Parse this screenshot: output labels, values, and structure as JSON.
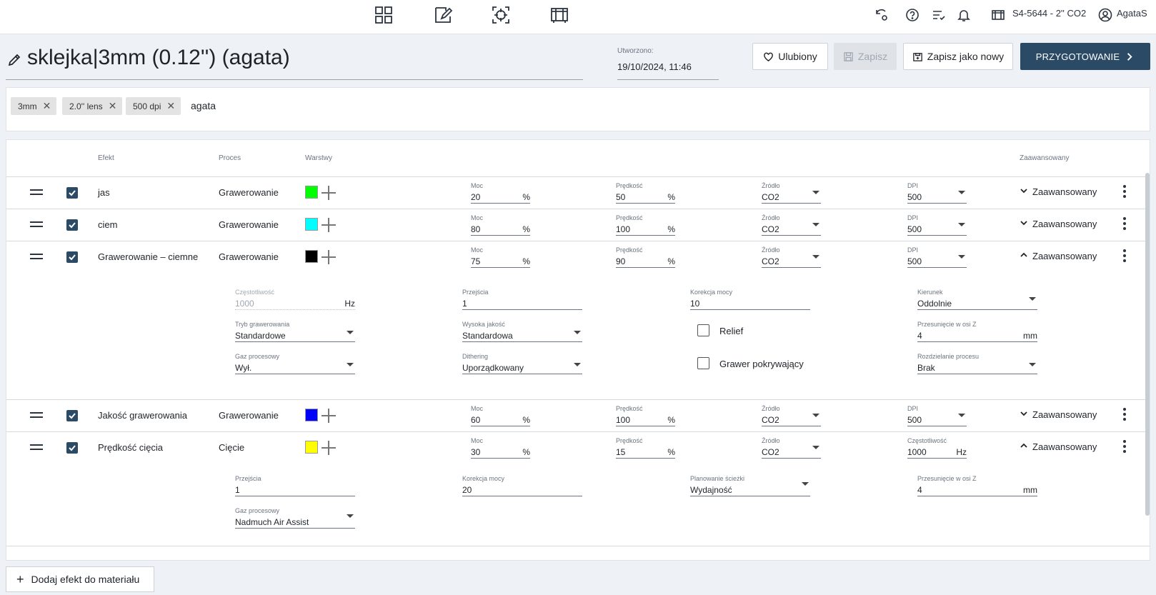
{
  "topbar": {
    "machine": "S4-5644 - 2'' CO2",
    "user": "AgataS",
    "nav_icons": [
      "grid-icon",
      "edit-design-icon",
      "crosshair-icon",
      "machine-icon"
    ],
    "right_icons": [
      "sync-settings-icon",
      "help-icon",
      "tasks-icon",
      "notifications-icon",
      "laser-machine-icon",
      "user-icon"
    ]
  },
  "header": {
    "title": "sklejka|3mm (0.12'') (agata)",
    "created_label": "Utworzono:",
    "created_value": "19/10/2024, 11:46",
    "favorite_label": "Ulubiony",
    "save_label": "Zapisz",
    "save_as_new_label": "Zapisz jako nowy",
    "prepare_label": "PRZYGOTOWANIE"
  },
  "tags": {
    "items": [
      "3mm",
      "2.0'' lens",
      "500 dpi"
    ],
    "input_value": "agata"
  },
  "table": {
    "headers": {
      "effect": "Efekt",
      "process": "Proces",
      "layers": "Warstwy",
      "advanced": "Zaawansowany"
    },
    "rows": [
      {
        "name": "jas",
        "process": "Grawerowanie",
        "color": "#00ff00",
        "moc_label": "Moc",
        "moc": "20",
        "moc_unit": "%",
        "speed_label": "Prędkość",
        "speed": "50",
        "speed_unit": "%",
        "source_label": "Źródło",
        "source": "CO2",
        "last_label": "DPI",
        "last": "500",
        "last_unit": "",
        "advanced_label": "Zaawansowany"
      },
      {
        "name": "ciem",
        "process": "Grawerowanie",
        "color": "#00ffff",
        "moc_label": "Moc",
        "moc": "80",
        "moc_unit": "%",
        "speed_label": "Prędkość",
        "speed": "100",
        "speed_unit": "%",
        "source_label": "Źródło",
        "source": "CO2",
        "last_label": "DPI",
        "last": "500",
        "last_unit": "",
        "advanced_label": "Zaawansowany"
      },
      {
        "name": "Grawerowanie – ciemne",
        "process": "Grawerowanie",
        "color": "#000000",
        "moc_label": "Moc",
        "moc": "75",
        "moc_unit": "%",
        "speed_label": "Prędkość",
        "speed": "90",
        "speed_unit": "%",
        "source_label": "Źródło",
        "source": "CO2",
        "last_label": "DPI",
        "last": "500",
        "last_unit": "",
        "advanced_label": "Zaawansowany"
      },
      {
        "name": "Jakość grawerowania",
        "process": "Grawerowanie",
        "color": "#0000ff",
        "moc_label": "Moc",
        "moc": "60",
        "moc_unit": "%",
        "speed_label": "Prędkość",
        "speed": "100",
        "speed_unit": "%",
        "source_label": "Źródło",
        "source": "CO2",
        "last_label": "DPI",
        "last": "500",
        "last_unit": "",
        "advanced_label": "Zaawansowany"
      },
      {
        "name": "Prędkość cięcia",
        "process": "Cięcie",
        "color": "#ffff00",
        "moc_label": "Moc",
        "moc": "30",
        "moc_unit": "%",
        "speed_label": "Prędkość",
        "speed": "15",
        "speed_unit": "%",
        "source_label": "Źródło",
        "source": "CO2",
        "last_label": "Częstotliwość",
        "last": "1000",
        "last_unit": "Hz",
        "advanced_label": "Zaawansowany"
      }
    ],
    "adv1": {
      "freq_label": "Częstotliwość",
      "freq_value": "1000",
      "freq_unit": "Hz",
      "passes_label": "Przejścia",
      "passes_value": "1",
      "power_corr_label": "Korekcja mocy",
      "power_corr_value": "10",
      "direction_label": "Kierunek",
      "direction_value": "Oddolnie",
      "mode_label": "Tryb grawerowania",
      "mode_value": "Standardowe",
      "hq_label": "Wysoka jakość",
      "hq_value": "Standardowa",
      "relief_label": "Relief",
      "zshift_label": "Przesunięcie w osi Z",
      "zshift_value": "4",
      "zshift_unit": "mm",
      "gas_label": "Gaz procesowy",
      "gas_value": "Wył.",
      "dithering_label": "Dithering",
      "dithering_value": "Uporządkowany",
      "overlap_label": "Grawer pokrywający",
      "split_label": "Rozdzielanie procesu",
      "split_value": "Brak"
    },
    "adv2": {
      "passes_label": "Przejścia",
      "passes_value": "1",
      "power_corr_label": "Korekcja mocy",
      "power_corr_value": "20",
      "path_label": "Planowanie ścieżki",
      "path_value": "Wydajność",
      "zshift_label": "Przesunięcie w osi Z",
      "zshift_value": "4",
      "zshift_unit": "mm",
      "gas_label": "Gaz procesowy",
      "gas_value": "Nadmuch Air Assist"
    }
  },
  "footer": {
    "add_effect_label": "Dodaj efekt do materiału"
  }
}
